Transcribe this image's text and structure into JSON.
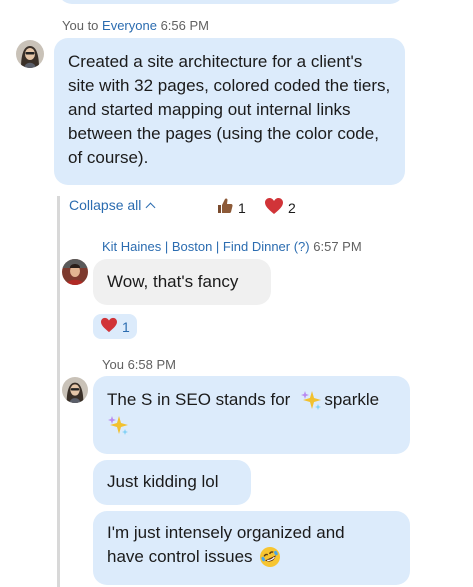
{
  "message1": {
    "sender": "You",
    "to_word": "to",
    "audience": "Everyone",
    "time": "6:56 PM",
    "text": "Created a site architecture for a client's site with 32 pages, colored coded the tiers, and started mapping out internal links between the pages (using the color code, of course)."
  },
  "thread": {
    "collapse_label": "Collapse all",
    "reactions": [
      {
        "emoji": "thumbs-up-icon",
        "count": "1"
      },
      {
        "emoji": "heart-icon",
        "count": "2"
      }
    ]
  },
  "reply1": {
    "sender": "Kit Haines | Boston | Find Dinner (?)",
    "time": "6:57 PM",
    "text": "Wow, that's fancy",
    "reaction_count": "1"
  },
  "reply2": {
    "sender": "You",
    "time": "6:58 PM",
    "line1_a": "The S in SEO stands for",
    "line1_b": "sparkle",
    "msg2": "Just kidding lol",
    "msg3_line1": "I'm just intensely organized and",
    "msg3_line2": "have control issues"
  },
  "colors": {
    "own_bubble": "#dcebfb",
    "other_bubble": "#f0f0f0",
    "link_blue": "#2b6cb0",
    "heart_red": "#d13438"
  }
}
